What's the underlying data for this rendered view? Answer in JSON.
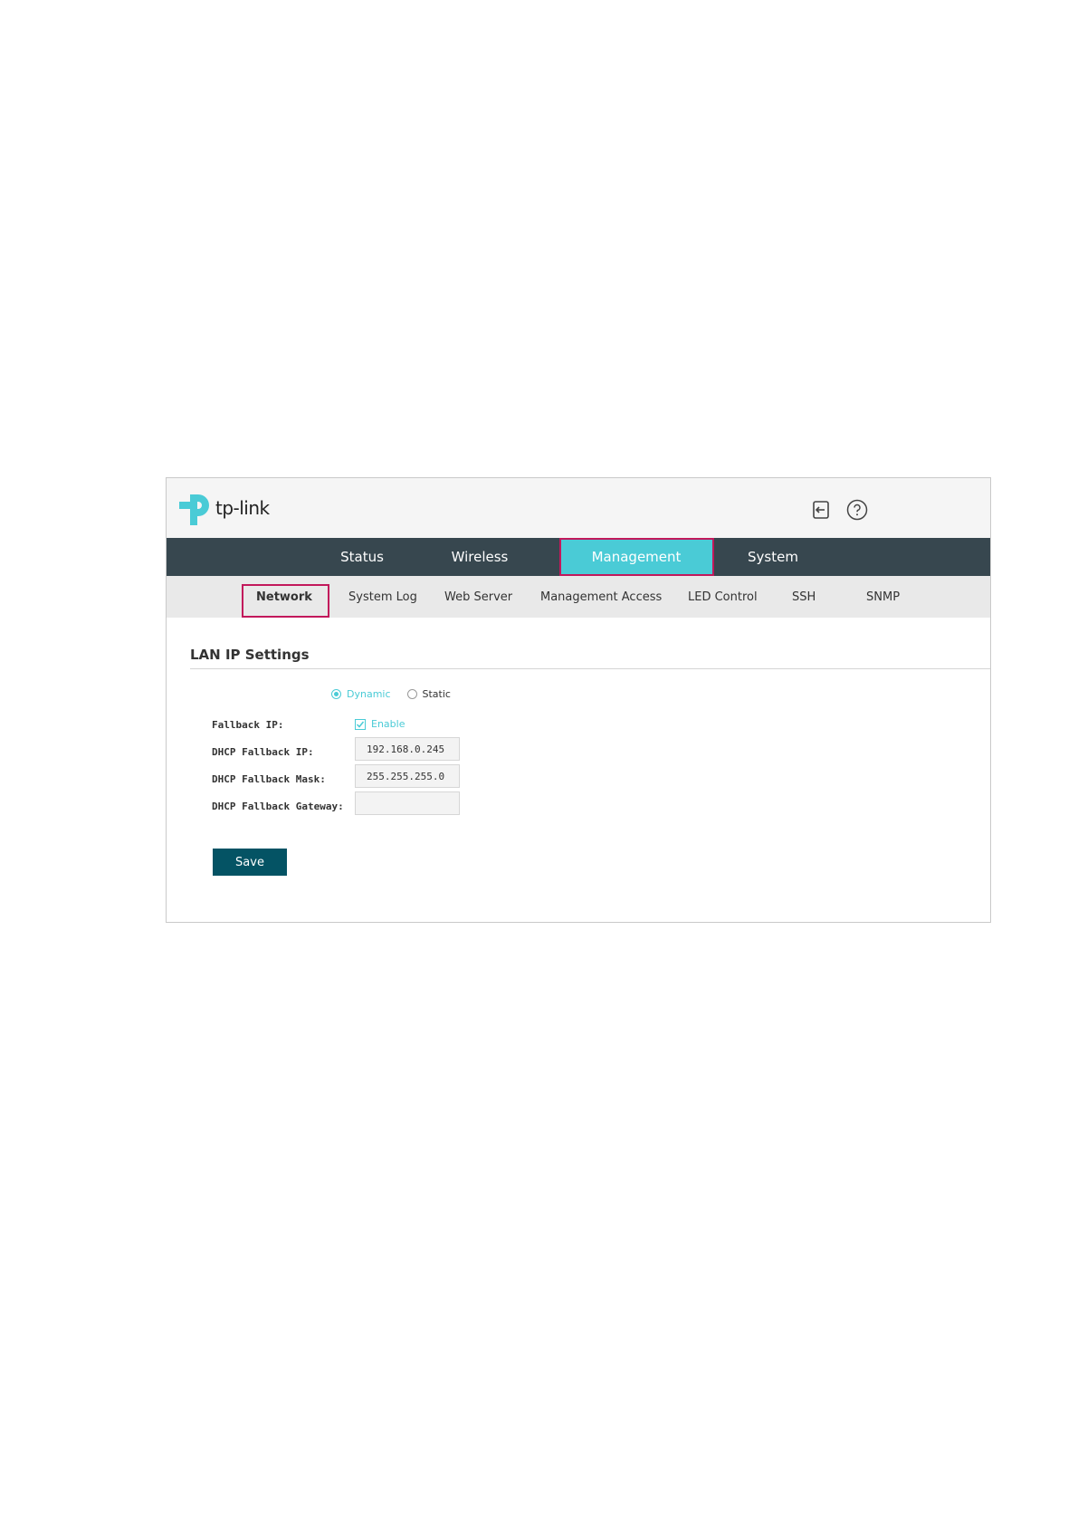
{
  "brand": {
    "logo_text": "tp-link",
    "accent": "#4acbd6",
    "nav_bg": "#37474f",
    "highlight": "#c2185b",
    "button_bg": "#045364"
  },
  "header": {
    "icons": [
      "logout-icon",
      "help-icon"
    ]
  },
  "main_nav": {
    "tabs": [
      {
        "label": "Status"
      },
      {
        "label": "Wireless"
      },
      {
        "label": "Management"
      },
      {
        "label": "System"
      }
    ],
    "active": "Management"
  },
  "sub_nav": {
    "tabs": [
      {
        "label": "Network"
      },
      {
        "label": "System Log"
      },
      {
        "label": "Web Server"
      },
      {
        "label": "Management Access"
      },
      {
        "label": "LED Control"
      },
      {
        "label": "SSH"
      },
      {
        "label": "SNMP"
      }
    ],
    "active": "Network"
  },
  "section": {
    "title": "LAN IP Settings"
  },
  "form": {
    "mode_options": [
      {
        "label": "Dynamic",
        "selected": true
      },
      {
        "label": "Static",
        "selected": false
      }
    ],
    "fallback_ip_label": "Fallback IP:",
    "fallback_enable_label": "Enable",
    "fallback_enabled": true,
    "dhcp_fallback_ip_label": "DHCP Fallback IP:",
    "dhcp_fallback_ip_value": "192.168.0.245",
    "dhcp_fallback_mask_label": "DHCP Fallback Mask:",
    "dhcp_fallback_mask_value": "255.255.255.0",
    "dhcp_fallback_gateway_label": "DHCP Fallback Gateway:",
    "dhcp_fallback_gateway_value": "",
    "save_label": "Save"
  }
}
